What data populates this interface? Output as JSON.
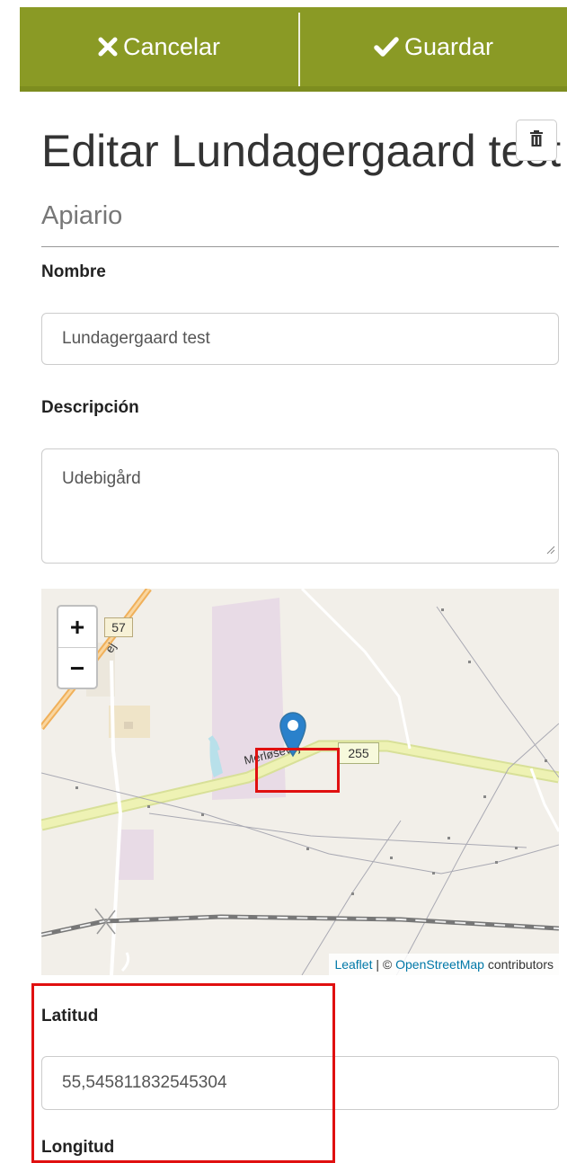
{
  "toolbar": {
    "cancel_label": "Cancelar",
    "save_label": "Guardar",
    "cancel_icon": "x-icon",
    "save_icon": "check-icon",
    "bg_color": "#8a9a25"
  },
  "header": {
    "title": "Editar Lundagergaard test",
    "subtitle": "Apiario",
    "delete_icon": "trash-icon"
  },
  "form": {
    "name_label": "Nombre",
    "name_value": "Lundagergaard test",
    "description_label": "Descripción",
    "description_value": "Udebigård",
    "latitude_label": "Latitud",
    "latitude_value": "55,545811832545304",
    "longitude_label": "Longitud"
  },
  "map": {
    "zoom_in": "+",
    "zoom_out": "−",
    "road_57": "57",
    "road_255": "255",
    "street_name": "Merløsevej",
    "street_fragment": "ej",
    "attribution": {
      "leaflet": "Leaflet",
      "separator": " | © ",
      "osm": "OpenStreetMap",
      "suffix": " contributors"
    }
  },
  "colors": {
    "highlight": "#e01010",
    "marker": "#2a81cb",
    "road": "#eef2b4"
  }
}
